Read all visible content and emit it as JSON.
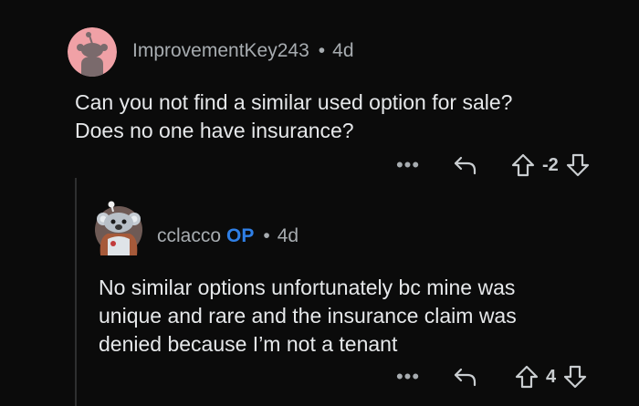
{
  "comments": [
    {
      "username": "ImprovementKey243",
      "is_op": false,
      "age": "4d",
      "separator": "•",
      "body_lines": [
        "Can you not find a similar used option for sale?",
        "Does no one have insurance?"
      ],
      "score": "-2",
      "more_label": "•••",
      "avatar_color": "#f0a1a6"
    },
    {
      "username": "cclacco",
      "is_op": true,
      "op_label": "OP",
      "age": "4d",
      "separator": "•",
      "body_lines": [
        "No similar options unfortunately bc mine was",
        "unique and rare and the insurance claim was",
        "denied because I’m not a tenant"
      ],
      "score": "4",
      "more_label": "•••",
      "avatar_color": "#9aa3ad"
    }
  ],
  "colors": {
    "background": "#0b0b0b",
    "op_badge": "#2f7fe6",
    "meta_text": "#a7acb0",
    "body_text": "#e6e8ea"
  },
  "icons": [
    "more-options-icon",
    "reply-icon",
    "upvote-icon",
    "downvote-icon"
  ]
}
